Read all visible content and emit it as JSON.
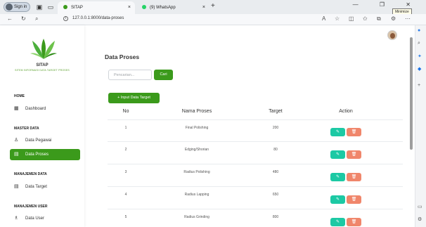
{
  "browser": {
    "signin_label": "Sign in",
    "tabs": [
      {
        "title": "SITAP",
        "close": "×"
      },
      {
        "title": "(9) WhatsApp",
        "close": "×"
      }
    ],
    "new_tab": "+",
    "window_controls": "— ❐ ✕",
    "tooltip": "Minimize",
    "url": "127.0.0.1:8000/data-proses",
    "icons": [
      "back-icon",
      "refresh-icon",
      "search-icon",
      "info-icon",
      "read-aloud-icon",
      "favorite-icon",
      "split-screen-icon",
      "favorites-icon",
      "collections-icon",
      "extensions-icon",
      "more-icon"
    ]
  },
  "sidebar": {
    "brand": "SITAP",
    "brand_sub": "SITEM INFORMASI DATA TARGET PROSES",
    "sections": [
      {
        "title": "HOME",
        "items": [
          {
            "label": "Dashboard",
            "icon": "grid-icon"
          }
        ]
      },
      {
        "title": "MASTER DATA",
        "items": [
          {
            "label": "Data Pegawai",
            "icon": "user-icon"
          },
          {
            "label": "Data Proses",
            "icon": "list-icon",
            "active": true
          }
        ]
      },
      {
        "title": "MANAJEMEN DATA",
        "items": [
          {
            "label": "Data Target",
            "icon": "table-icon"
          }
        ]
      },
      {
        "title": "MANAJEMEN USER",
        "items": [
          {
            "label": "Data User",
            "icon": "users-icon"
          }
        ]
      }
    ]
  },
  "main": {
    "title": "Data Proses",
    "search_placeholder": "Pencarian...",
    "search_button": "Cari",
    "add_button": "+ Input Data Target",
    "table": {
      "headers": [
        "No",
        "Nama Proses",
        "Target",
        "Action"
      ],
      "rows": [
        {
          "no": "1",
          "nama": "Final Polishing",
          "target": "200"
        },
        {
          "no": "2",
          "nama": "Edging/Shorian",
          "target": "80"
        },
        {
          "no": "3",
          "nama": "Radius Polishing",
          "target": "480"
        },
        {
          "no": "4",
          "nama": "Radius Lapping",
          "target": "650"
        },
        {
          "no": "5",
          "nama": "Radius Grinding",
          "target": "800"
        }
      ],
      "edit_glyph": "✎",
      "delete_glyph": "🗑"
    }
  },
  "colors": {
    "accent": "#3b9a1b",
    "edit": "#1cc9a4",
    "delete": "#f0866b"
  }
}
